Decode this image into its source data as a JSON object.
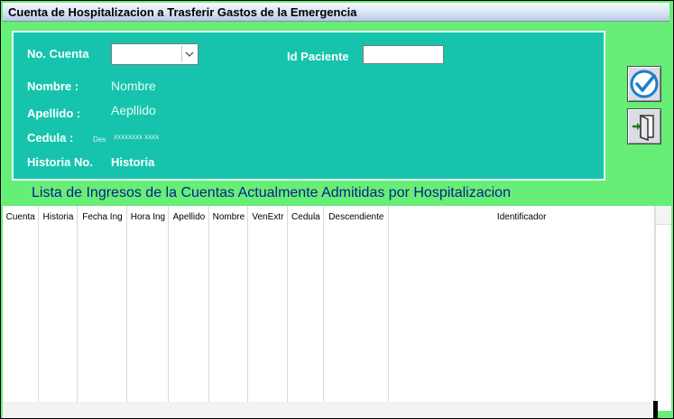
{
  "window": {
    "title": "Cuenta de Hospitalizacion a Trasferir Gastos de la Emergencia"
  },
  "form": {
    "no_cuenta_label": "No. Cuenta",
    "no_cuenta_value": "",
    "id_paciente_label": "Id Paciente",
    "id_paciente_value": "",
    "nombre_label": "Nombre :",
    "nombre_value": "Nombre",
    "apellido_label": "Apellido :",
    "apellido_value": "Aepllido",
    "cedula_label": "Cedula :",
    "cedula_prefix": "Des",
    "cedula_mask": "xxxxxxxx  xxxx",
    "historia_label": "Historia No.",
    "historia_value": "Historia"
  },
  "toolbar": {
    "accept_icon": "check-circle-icon",
    "exit_icon": "exit-door-icon"
  },
  "list": {
    "caption": "Lista de Ingresos de la Cuentas Actualmente Admitidas por Hospitalizacion",
    "columns": [
      "Cuenta",
      "Historia",
      "Fecha Ing",
      "Hora Ing",
      "Apellido",
      "Nombre",
      "VenExtr",
      "Cedula",
      "Descendiente",
      "Identificador"
    ],
    "rows": []
  },
  "colors": {
    "panel": "#16c4ae",
    "background": "#66ee77",
    "caption": "#0b1f8a"
  }
}
